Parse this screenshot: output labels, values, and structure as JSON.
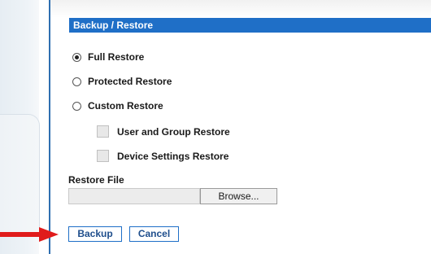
{
  "header": {
    "title": "Backup / Restore"
  },
  "restore_options": [
    {
      "label": "Full Restore",
      "selected": true
    },
    {
      "label": "Protected Restore",
      "selected": false
    },
    {
      "label": "Custom Restore",
      "selected": false
    }
  ],
  "custom_options": [
    {
      "label": "User and Group Restore",
      "checked": false
    },
    {
      "label": "Device Settings Restore",
      "checked": false
    }
  ],
  "restore_file": {
    "label": "Restore File",
    "value": "",
    "browse_label": "Browse..."
  },
  "actions": {
    "backup_label": "Backup",
    "cancel_label": "Cancel"
  },
  "annotation": {
    "arrow_color": "#e01b1b"
  },
  "colors": {
    "header_bg": "#1f6fc7",
    "accent": "#1f6fc7"
  }
}
